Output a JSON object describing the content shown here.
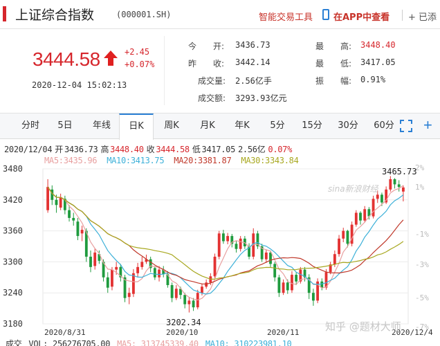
{
  "header": {
    "stock_name": "上证综合指数",
    "stock_code": "(000001.SH)",
    "smart_trade_tool": "智能交易工具",
    "app_view": "在APP中查看",
    "add_watch": "+ 已添"
  },
  "quote": {
    "price": "3444.58",
    "change": "+2.45",
    "change_pct": "+0.07%",
    "time": "2020-12-04 15:02:13",
    "stats": [
      {
        "label": "今　　开:",
        "value": "3436.73",
        "color": "dark"
      },
      {
        "label": "最　　高:",
        "value": "3448.40",
        "color": "red"
      },
      {
        "label": "昨　　收:",
        "value": "3442.14",
        "color": "dark"
      },
      {
        "label": "最　　低:",
        "value": "3417.05",
        "color": "dark"
      },
      {
        "label": "成交量:",
        "value": "2.56亿手",
        "color": "dark"
      },
      {
        "label": "振　　幅:",
        "value": "0.91%",
        "color": "dark"
      },
      {
        "label": "成交额:",
        "value": "3293.93亿元",
        "color": "dark"
      }
    ]
  },
  "tabs": [
    "分时",
    "5日",
    "年线",
    "日K",
    "周K",
    "月K",
    "年K",
    "5分",
    "15分",
    "30分",
    "60分"
  ],
  "active_tab": "日K",
  "kline_info": {
    "date": "2020/12/04",
    "open_label": "开",
    "open": "3436.73",
    "high_label": "高",
    "high": "3448.40",
    "close_label": "收",
    "close": "3444.58",
    "low_label": "低",
    "low": "3417.05",
    "vol": "2.56亿",
    "pct": "0.07%"
  },
  "ma_info": [
    {
      "label": "MA5:",
      "value": "3435.96",
      "color": "#e8a0a0"
    },
    {
      "label": "MA10:",
      "value": "3413.75",
      "color": "#3cb0d8"
    },
    {
      "label": "MA20:",
      "value": "3381.87",
      "color": "#c0392b"
    },
    {
      "label": "MA30:",
      "value": "3343.84",
      "color": "#a8a820"
    }
  ],
  "volume_info": {
    "label": "成交",
    "vol": "VOL: 256276705.00",
    "ma5": "MA5: 313745339.40",
    "ma10": "MA10: 310223981.10"
  },
  "watermarks": {
    "sina": "sina新浪财经",
    "zhihu": "知乎 @题材大师"
  },
  "colors": {
    "up": "#e33232",
    "down": "#1f9b3e",
    "accent": "#2a7fd4"
  },
  "chart_data": {
    "type": "candlestick",
    "y_axis_ticks": [
      3180,
      3240,
      3300,
      3360,
      3420,
      3480
    ],
    "pct_ticks": [
      "2%",
      "1%",
      "-1%",
      "-3%",
      "-5%",
      "-7%"
    ],
    "x_labels": [
      "2020/8/31",
      "2020/10",
      "2020/11",
      "2020/12/4"
    ],
    "ylim": [
      3180,
      3480
    ],
    "annotations": {
      "high": "3465.73",
      "low": "3202.34"
    },
    "candles": [
      [
        3400,
        3445,
        3395,
        3460
      ],
      [
        3440,
        3420,
        3410,
        3448
      ],
      [
        3420,
        3410,
        3395,
        3430
      ],
      [
        3405,
        3425,
        3400,
        3432
      ],
      [
        3422,
        3400,
        3392,
        3428
      ],
      [
        3400,
        3385,
        3378,
        3410
      ],
      [
        3385,
        3380,
        3370,
        3395
      ],
      [
        3378,
        3350,
        3342,
        3385
      ],
      [
        3355,
        3362,
        3340,
        3370
      ],
      [
        3360,
        3310,
        3300,
        3365
      ],
      [
        3310,
        3290,
        3280,
        3322
      ],
      [
        3292,
        3318,
        3285,
        3326
      ],
      [
        3315,
        3302,
        3296,
        3322
      ],
      [
        3300,
        3270,
        3262,
        3305
      ],
      [
        3270,
        3250,
        3240,
        3280
      ],
      [
        3252,
        3285,
        3245,
        3290
      ],
      [
        3285,
        3290,
        3275,
        3300
      ],
      [
        3290,
        3270,
        3262,
        3296
      ],
      [
        3270,
        3230,
        3222,
        3275
      ],
      [
        3232,
        3240,
        3218,
        3250
      ],
      [
        3238,
        3278,
        3232,
        3286
      ],
      [
        3278,
        3290,
        3270,
        3298
      ],
      [
        3290,
        3300,
        3285,
        3310
      ],
      [
        3300,
        3305,
        3296,
        3314
      ],
      [
        3305,
        3288,
        3280,
        3310
      ],
      [
        3288,
        3270,
        3265,
        3292
      ],
      [
        3270,
        3285,
        3262,
        3292
      ],
      [
        3285,
        3276,
        3270,
        3292
      ],
      [
        3276,
        3255,
        3250,
        3282
      ],
      [
        3255,
        3230,
        3222,
        3260
      ],
      [
        3230,
        3248,
        3226,
        3255
      ],
      [
        3248,
        3236,
        3228,
        3252
      ],
      [
        3236,
        3218,
        3210,
        3240
      ],
      [
        3218,
        3225,
        3202,
        3232
      ],
      [
        3225,
        3212,
        3205,
        3230
      ],
      [
        3212,
        3240,
        3208,
        3246
      ],
      [
        3240,
        3252,
        3235,
        3258
      ],
      [
        3252,
        3260,
        3248,
        3266
      ],
      [
        3260,
        3272,
        3255,
        3278
      ],
      [
        3272,
        3310,
        3268,
        3316
      ],
      [
        3310,
        3355,
        3305,
        3360
      ],
      [
        3355,
        3340,
        3335,
        3362
      ],
      [
        3340,
        3350,
        3334,
        3356
      ],
      [
        3350,
        3335,
        3328,
        3354
      ],
      [
        3335,
        3325,
        3318,
        3340
      ],
      [
        3325,
        3345,
        3320,
        3350
      ],
      [
        3345,
        3330,
        3325,
        3350
      ],
      [
        3330,
        3310,
        3305,
        3336
      ],
      [
        3310,
        3355,
        3305,
        3365
      ],
      [
        3355,
        3330,
        3325,
        3360
      ],
      [
        3330,
        3305,
        3300,
        3335
      ],
      [
        3305,
        3318,
        3298,
        3324
      ],
      [
        3318,
        3296,
        3290,
        3322
      ],
      [
        3296,
        3270,
        3262,
        3300
      ],
      [
        3270,
        3240,
        3232,
        3275
      ],
      [
        3240,
        3260,
        3236,
        3266
      ],
      [
        3260,
        3245,
        3238,
        3266
      ],
      [
        3245,
        3275,
        3240,
        3282
      ],
      [
        3275,
        3262,
        3255,
        3280
      ],
      [
        3262,
        3285,
        3258,
        3290
      ],
      [
        3285,
        3270,
        3262,
        3290
      ],
      [
        3270,
        3240,
        3228,
        3276
      ],
      [
        3240,
        3225,
        3215,
        3248
      ],
      [
        3225,
        3262,
        3220,
        3268
      ],
      [
        3262,
        3250,
        3245,
        3268
      ],
      [
        3250,
        3280,
        3246,
        3286
      ],
      [
        3280,
        3295,
        3276,
        3300
      ],
      [
        3295,
        3315,
        3290,
        3322
      ],
      [
        3315,
        3345,
        3310,
        3352
      ],
      [
        3345,
        3360,
        3338,
        3366
      ],
      [
        3360,
        3335,
        3328,
        3362
      ],
      [
        3335,
        3372,
        3330,
        3378
      ],
      [
        3372,
        3395,
        3368,
        3400
      ],
      [
        3395,
        3380,
        3372,
        3398
      ],
      [
        3380,
        3402,
        3376,
        3408
      ],
      [
        3402,
        3388,
        3382,
        3406
      ],
      [
        3388,
        3422,
        3384,
        3428
      ],
      [
        3422,
        3430,
        3414,
        3438
      ],
      [
        3430,
        3415,
        3408,
        3434
      ],
      [
        3415,
        3440,
        3412,
        3446
      ],
      [
        3440,
        3460,
        3436,
        3466
      ],
      [
        3460,
        3450,
        3442,
        3462
      ],
      [
        3450,
        3445,
        3436,
        3458
      ],
      [
        3436,
        3444,
        3417,
        3448
      ]
    ]
  }
}
